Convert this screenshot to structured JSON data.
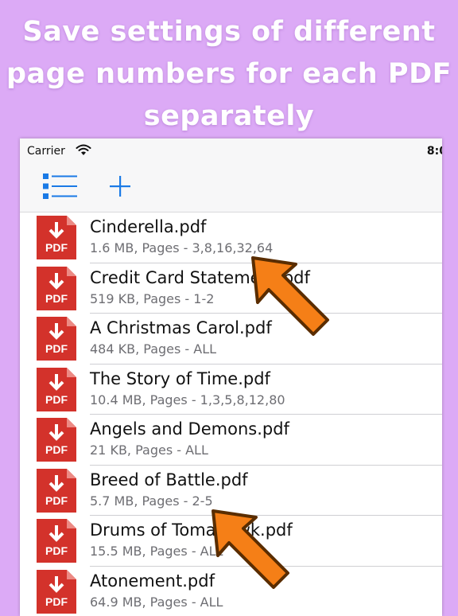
{
  "headline": {
    "line1": "Save settings of different",
    "line2": "page numbers for each PDF",
    "line3": "separately"
  },
  "statusbar": {
    "carrier": "Carrier",
    "time": "8:0"
  },
  "toolbar": {
    "list_icon": "list-icon",
    "add_icon": "plus-icon"
  },
  "files": [
    {
      "name": "Cinderella.pdf",
      "meta": "1.6 MB, Pages - 3,8,16,32,64"
    },
    {
      "name": "Credit Card Statement.pdf",
      "meta": "519 KB, Pages - 1-2"
    },
    {
      "name": "A Christmas Carol.pdf",
      "meta": "484 KB, Pages - ALL"
    },
    {
      "name": "The Story of Time.pdf",
      "meta": "10.4 MB, Pages - 1,3,5,8,12,80"
    },
    {
      "name": "Angels and Demons.pdf",
      "meta": "21 KB, Pages - ALL"
    },
    {
      "name": "Breed of Battle.pdf",
      "meta": "5.7 MB, Pages - 2-5"
    },
    {
      "name": "Drums of Tomahawk.pdf",
      "meta": "15.5 MB, Pages - ALL"
    },
    {
      "name": "Atonement.pdf",
      "meta": "64.9 MB, Pages - ALL"
    }
  ],
  "pdf_badge": "PDF",
  "colors": {
    "background": "#dcaaf6",
    "accent": "#1a7ae6",
    "pdf_red": "#d3322b",
    "arrow": "#f57f17"
  }
}
